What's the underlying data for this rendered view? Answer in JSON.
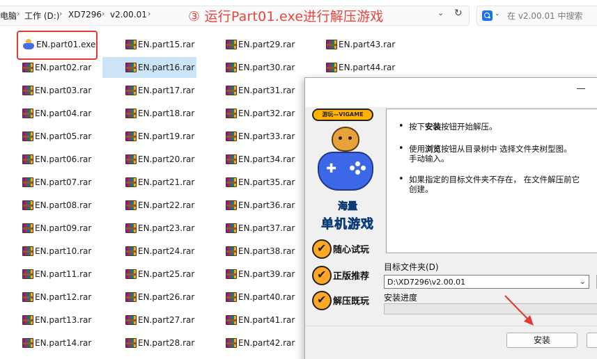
{
  "breadcrumb": {
    "items": [
      "电脑",
      "工作 (D:)",
      "XD7296",
      "v2.00.01"
    ],
    "separator": "›"
  },
  "annotation": {
    "text": "③ 运行Part01.exe进行解压游戏",
    "color": "#e8453c"
  },
  "search": {
    "placeholder": "在 v2.00.01 中搜索"
  },
  "files": {
    "col1": [
      "EN.part01.exe",
      "EN.part02.rar",
      "EN.part03.rar",
      "EN.part04.rar",
      "EN.part05.rar",
      "EN.part06.rar",
      "EN.part07.rar",
      "EN.part08.rar",
      "EN.part09.rar",
      "EN.part10.rar",
      "EN.part11.rar",
      "EN.part12.rar",
      "EN.part13.rar",
      "EN.part14.rar"
    ],
    "col2": [
      "EN.part15.rar",
      "EN.part16.rar",
      "EN.part17.rar",
      "EN.part18.rar",
      "EN.part19.rar",
      "EN.part20.rar",
      "EN.part21.rar",
      "EN.part22.rar",
      "EN.part23.rar",
      "EN.part24.rar",
      "EN.part25.rar",
      "EN.part26.rar",
      "EN.part27.rar",
      "EN.part28.rar"
    ],
    "col3": [
      "EN.part29.rar",
      "EN.part30.rar",
      "EN.part31.rar",
      "EN.part32.rar",
      "EN.part33.rar",
      "EN.part34.rar",
      "EN.part35.rar",
      "EN.part36.rar",
      "EN.part37.rar",
      "EN.part38.rar",
      "EN.part39.rar",
      "EN.part40.rar",
      "EN.part41.rar",
      "EN.part42.rar"
    ],
    "col4": [
      "EN.part43.rar",
      "EN.part44.rar"
    ]
  },
  "installer": {
    "side": {
      "badge": "游玩—VIGAME",
      "brand_line1": "海量",
      "brand_line2": "单机游戏",
      "features": [
        "随心试玩",
        "正版推荐",
        "解压既玩"
      ]
    },
    "info": {
      "line1_pre": "按下",
      "line1_bold": "安装",
      "line1_post": "按钮开始解压。",
      "line2_pre": "使用",
      "line2_bold": "浏览",
      "line2_post": "按钮从目录树中  选择文件夹树型图。",
      "line2_cont": "手动输入。",
      "line3": "如果指定的目标文件夹不存在，  在文件解压前它",
      "line3_cont": "创建。"
    },
    "dest_label": "目标文件夹(D)",
    "dest_value": "D:\\XD7296\\v2.00.01",
    "progress_label": "安装进度",
    "progress_value": 0,
    "install_button": "安装"
  },
  "colors": {
    "highlight_box": "#e53935",
    "arrow": "#e53935",
    "selection": "#cce4f7"
  }
}
